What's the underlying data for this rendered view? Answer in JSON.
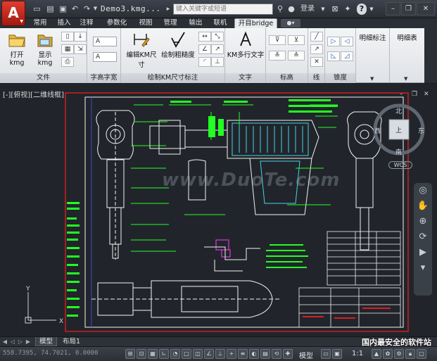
{
  "app": {
    "logo_letter": "A",
    "title": "Demo3.kmg...",
    "search_placeholder": "键入关键字或短语",
    "login_label": "登录",
    "help_label": "?"
  },
  "ribbon": {
    "tabs": [
      {
        "label": "常用"
      },
      {
        "label": "插入"
      },
      {
        "label": "注释"
      },
      {
        "label": "参数化"
      },
      {
        "label": "视图"
      },
      {
        "label": "管理"
      },
      {
        "label": "输出"
      },
      {
        "label": "联机"
      },
      {
        "label": "开目bridge",
        "active": true
      }
    ],
    "panels": {
      "file": {
        "title": "文件",
        "open_label": "打开kmg",
        "show_label": "显示kmg"
      },
      "text_height": {
        "title": "字高字宽",
        "combo1": "A",
        "combo2": "A"
      },
      "dim": {
        "title": "绘制KM尺寸标注",
        "edit_label": "编辑KM尺寸",
        "rough_label": "绘制粗糙度"
      },
      "text": {
        "title": "文字",
        "multi_label": "KM多行文字"
      },
      "mark": {
        "title": "标高"
      },
      "line": {
        "title": "线"
      },
      "taper": {
        "title": "锥度"
      },
      "bom_mark": {
        "title": "明细标注"
      },
      "bom_table": {
        "title": "明细表"
      }
    }
  },
  "viewport": {
    "label": "[-][俯视][二维线框]",
    "watermark": "www.DuoTe.com",
    "wcs_label": "WCS",
    "compass": {
      "north": "北",
      "south": "南",
      "east": "东",
      "west": "西",
      "top": "上"
    }
  },
  "layout_tabs": [
    {
      "label": "模型",
      "active": true
    },
    {
      "label": "布局1"
    }
  ],
  "site_mark": "国内最安全的软件站",
  "status": {
    "coords": "558.7395, 74.7021, 0.0000",
    "model_label": "模型",
    "scale_label": "1:1"
  },
  "colors": {
    "titlebar": "#2a2e35",
    "ribbon_bg": "#e9ecef",
    "canvas_bg": "#21252b",
    "border_red": "#d91f1f",
    "dim_green": "#22ff22",
    "geometry_white": "#f2f2f2",
    "section_cyan": "#46d3e6",
    "accent_magenta": "#ff3df5"
  }
}
